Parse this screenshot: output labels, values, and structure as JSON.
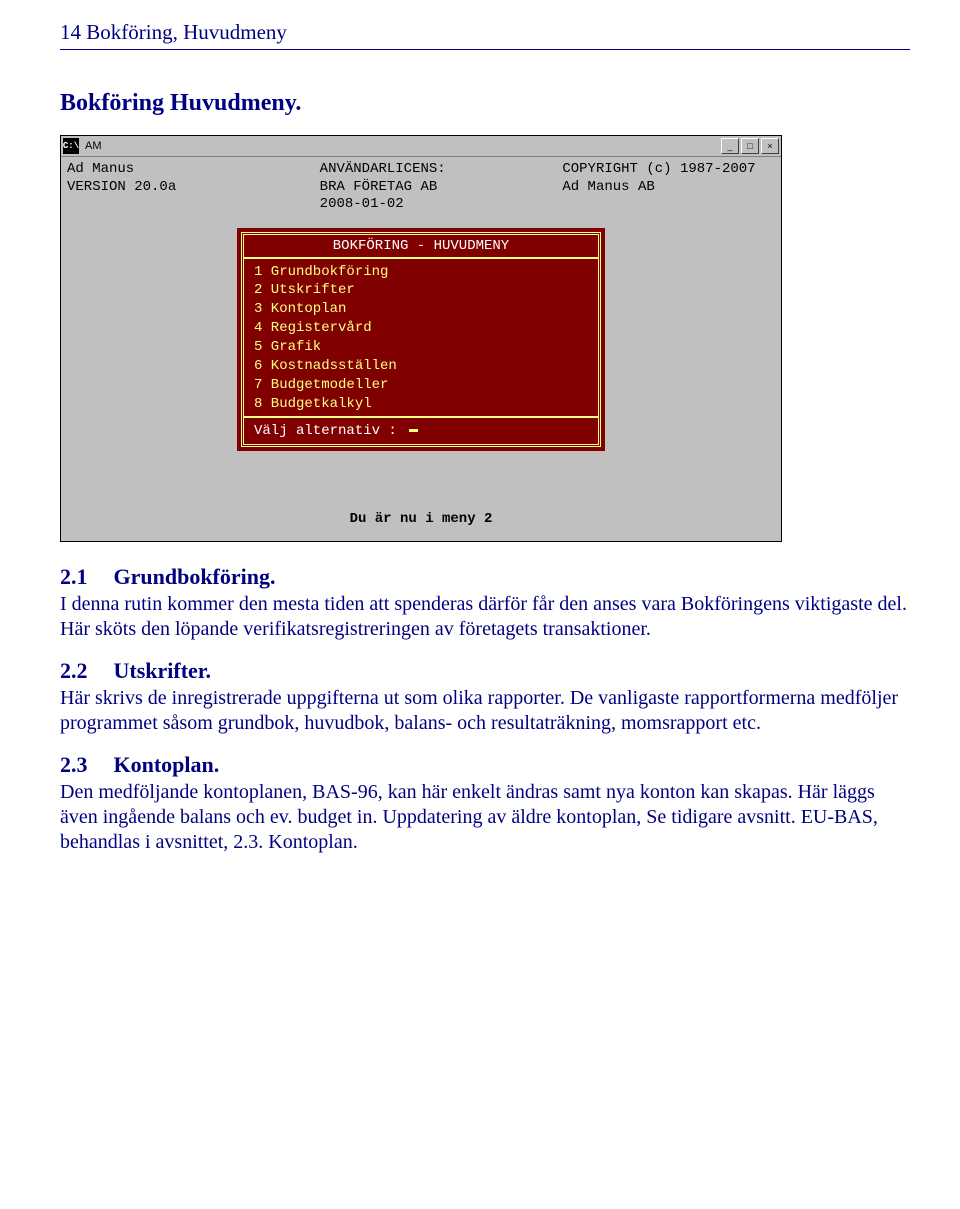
{
  "page": {
    "header": "14  Bokföring, Huvudmeny",
    "title": "Bokföring Huvudmeny."
  },
  "window": {
    "icon_text": "C:\\",
    "title": "AM",
    "info": {
      "left_line1": "Ad Manus",
      "left_line2": "VERSION 20.0a",
      "center_line1": "ANVÄNDARLICENS:",
      "center_line2": "BRA FÖRETAG AB",
      "center_line3": "2008-01-02",
      "right_line1": "COPYRIGHT (c) 1987-2007",
      "right_line2": "Ad Manus AB"
    },
    "menu": {
      "heading": "BOKFÖRING - HUVUDMENY",
      "items": [
        "1 Grundbokföring",
        "2 Utskrifter",
        "3 Kontoplan",
        "4 Registervård",
        "5 Grafik",
        "6 Kostnadsställen",
        "7 Budgetmodeller",
        "8 Budgetkalkyl"
      ],
      "prompt": "Välj alternativ :"
    },
    "status": "Du är nu i meny 2"
  },
  "sections": {
    "s1": {
      "num": "2.1",
      "title": "Grundbokföring.",
      "body": "I denna rutin kommer den mesta tiden att spenderas därför får den anses vara Bokföringens viktigaste del. Här sköts den löpande verifikats­registreringen av företagets transaktioner."
    },
    "s2": {
      "num": "2.2",
      "title": "Utskrifter.",
      "body": "Här skrivs de inregistrerade uppgifterna ut som olika rapporter. De vanligaste rapportformerna medföljer programmet såsom grund­bok, huvudbok, balans- och resultaträkning, momsrapport etc."
    },
    "s3": {
      "num": "2.3",
      "title": "Kontoplan.",
      "body": "Den medföljande kontoplanen, BAS-96, kan här enkelt ändras samt nya konton kan skapas. Här läggs även ingående balans och ev. budget in. Uppdatering av äldre kontoplan, Se tidigare avsnitt. EU-BAS, behandlas i avsnittet, 2.3. Kontoplan."
    }
  }
}
